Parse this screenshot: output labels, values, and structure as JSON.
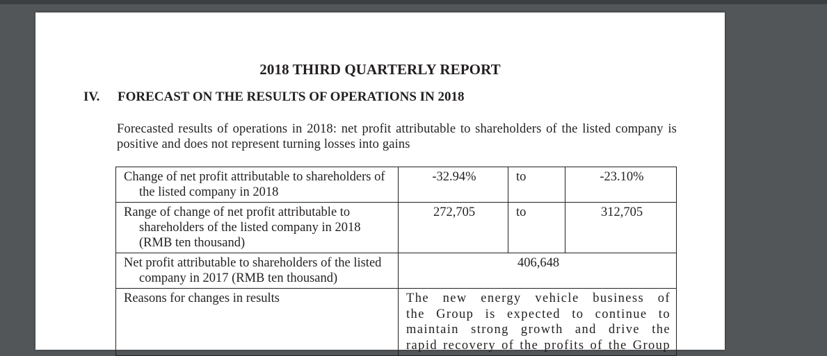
{
  "document": {
    "title": "2018 THIRD QUARTERLY REPORT",
    "section": {
      "number": "IV.",
      "heading": "FORECAST ON THE RESULTS OF OPERATIONS IN 2018"
    },
    "intro": "Forecasted results of operations in 2018: net profit attributable to shareholders of the listed company is positive and does not represent turning losses into gains",
    "table": {
      "rows": [
        {
          "label": "Change of net profit attributable to shareholders of the listed company in 2018",
          "from": "-32.94%",
          "to_word": "to",
          "to_value": "-23.10%"
        },
        {
          "label": "Range of change of net profit attributable to shareholders of the listed company in 2018 (RMB ten thousand)",
          "from": "272,705",
          "to_word": "to",
          "to_value": "312,705"
        },
        {
          "label": "Net profit attributable to shareholders of the listed company in 2017 (RMB ten thousand)",
          "value": "406,648"
        },
        {
          "label": "Reasons for changes in results",
          "reason_lines": [
            "The new energy vehicle business of",
            "the Group is expected to continue to",
            "maintain strong growth and drive the",
            "rapid recovery of the profits of the Group"
          ]
        }
      ]
    }
  }
}
